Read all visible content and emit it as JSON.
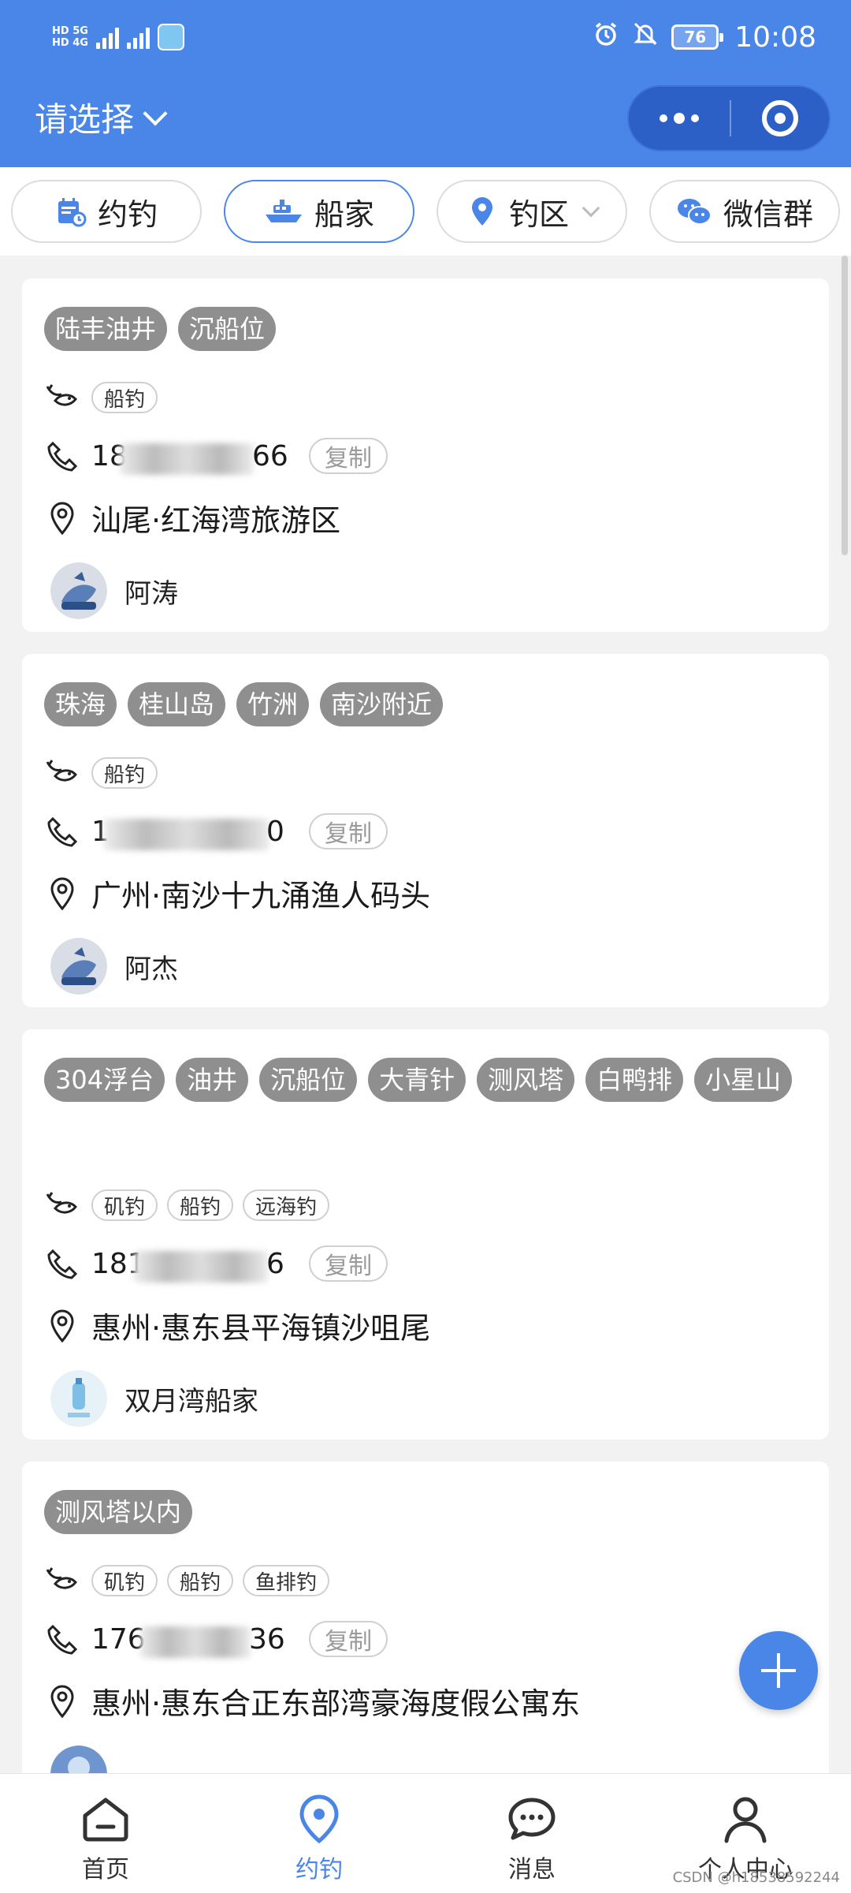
{
  "status_bar": {
    "network_top": "HD 5G",
    "network_bottom": "HD 4G",
    "battery": "76",
    "time": "10:08"
  },
  "nav": {
    "title": "请选择",
    "accent": "#4a86e8"
  },
  "tabs": [
    {
      "label": "约钓",
      "icon": "calendar-icon"
    },
    {
      "label": "船家",
      "icon": "boat-icon"
    },
    {
      "label": "钓区",
      "icon": "location-icon"
    },
    {
      "label": "微信群",
      "icon": "wechat-icon"
    }
  ],
  "cards": [
    {
      "tags": [
        "陆丰油井",
        "沉船位"
      ],
      "methods": [
        "船钓"
      ],
      "phone_start": "18",
      "phone_end": "66",
      "copy": "复制",
      "address": "汕尾·红海湾旅游区",
      "user": "阿涛"
    },
    {
      "tags": [
        "珠海",
        "桂山岛",
        "竹洲",
        "南沙附近"
      ],
      "methods": [
        "船钓"
      ],
      "phone_start": "1",
      "phone_end": "0",
      "copy": "复制",
      "address": "广州·南沙十九涌渔人码头",
      "user": "阿杰"
    },
    {
      "tags": [
        "304浮台",
        "油井",
        "沉船位",
        "大青针",
        "测风塔",
        "白鸭排",
        "小星山"
      ],
      "methods": [
        "矶钓",
        "船钓",
        "远海钓"
      ],
      "phone_start": "181",
      "phone_end": "6",
      "copy": "复制",
      "address": "惠州·惠东县平海镇沙咀尾",
      "user": "双月湾船家"
    },
    {
      "tags": [
        "测风塔以内"
      ],
      "methods": [
        "矶钓",
        "船钓",
        "鱼排钓"
      ],
      "phone_start": "176",
      "phone_end": "36",
      "copy": "复制",
      "address": "惠州·惠东合正东部湾豪海度假公寓东",
      "user": ""
    }
  ],
  "bottom_nav": [
    {
      "label": "首页",
      "icon": "home-icon"
    },
    {
      "label": "约钓",
      "icon": "location-icon"
    },
    {
      "label": "消息",
      "icon": "chat-icon"
    },
    {
      "label": "个人中心",
      "icon": "person-icon"
    }
  ],
  "watermark": "CSDN @h18538592244"
}
